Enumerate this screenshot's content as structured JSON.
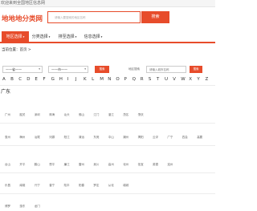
{
  "topbar": {
    "text": "欢迎来到全国地区信息网"
  },
  "logo": {
    "text": "地地地分类网"
  },
  "search": {
    "placeholder": "请输入要搜索的地区名称",
    "button_label": "搜索"
  },
  "nav": {
    "items": [
      {
        "label": "地区选择",
        "active": true
      },
      {
        "label": "分类选择",
        "active": false
      },
      {
        "label": "排至选择",
        "active": false
      },
      {
        "label": "信息选择",
        "active": false
      }
    ]
  },
  "breadcrumb": {
    "text": "当前位置：首页 >"
  },
  "filter": {
    "province_select": "——省——",
    "city_select": "——市——",
    "go_label": "搜索",
    "keyword_label": "地区搜索",
    "keyword_placeholder": "请输入城市名称",
    "keyword_button": "搜索"
  },
  "letters": [
    "A",
    "B",
    "C",
    "D",
    "E",
    "F",
    "G",
    "H",
    "I",
    "J",
    "K",
    "L",
    "M",
    "N",
    "O",
    "P",
    "Q",
    "R",
    "S",
    "T",
    "U",
    "V",
    "W",
    "X",
    "Y",
    "Z"
  ],
  "province": {
    "title": "广东"
  },
  "city_rows": [
    [
      "广州",
      "韶关",
      "深圳",
      "珠海",
      "汕头",
      "佛山",
      "江门",
      "湛江",
      "茂名",
      "肇庆"
    ],
    [
      "惠州",
      "梅州",
      "汕尾",
      "河源",
      "阳江",
      "清远",
      "东莞",
      "中山",
      "潮州",
      "揭阳",
      "云浮",
      "广宁",
      "四会",
      "高要"
    ],
    [
      "台山",
      "开平",
      "鹤山",
      "恩平",
      "廉江",
      "雷州",
      "吴川",
      "高州",
      "化州",
      "信宜",
      "英德",
      "连州"
    ],
    [
      "乐昌",
      "南雄",
      "兴宁",
      "普宁",
      "陆丰",
      "阳春",
      "罗定",
      "从化",
      "增城"
    ],
    [
      "博罗",
      "惠东",
      "龙门"
    ]
  ]
}
